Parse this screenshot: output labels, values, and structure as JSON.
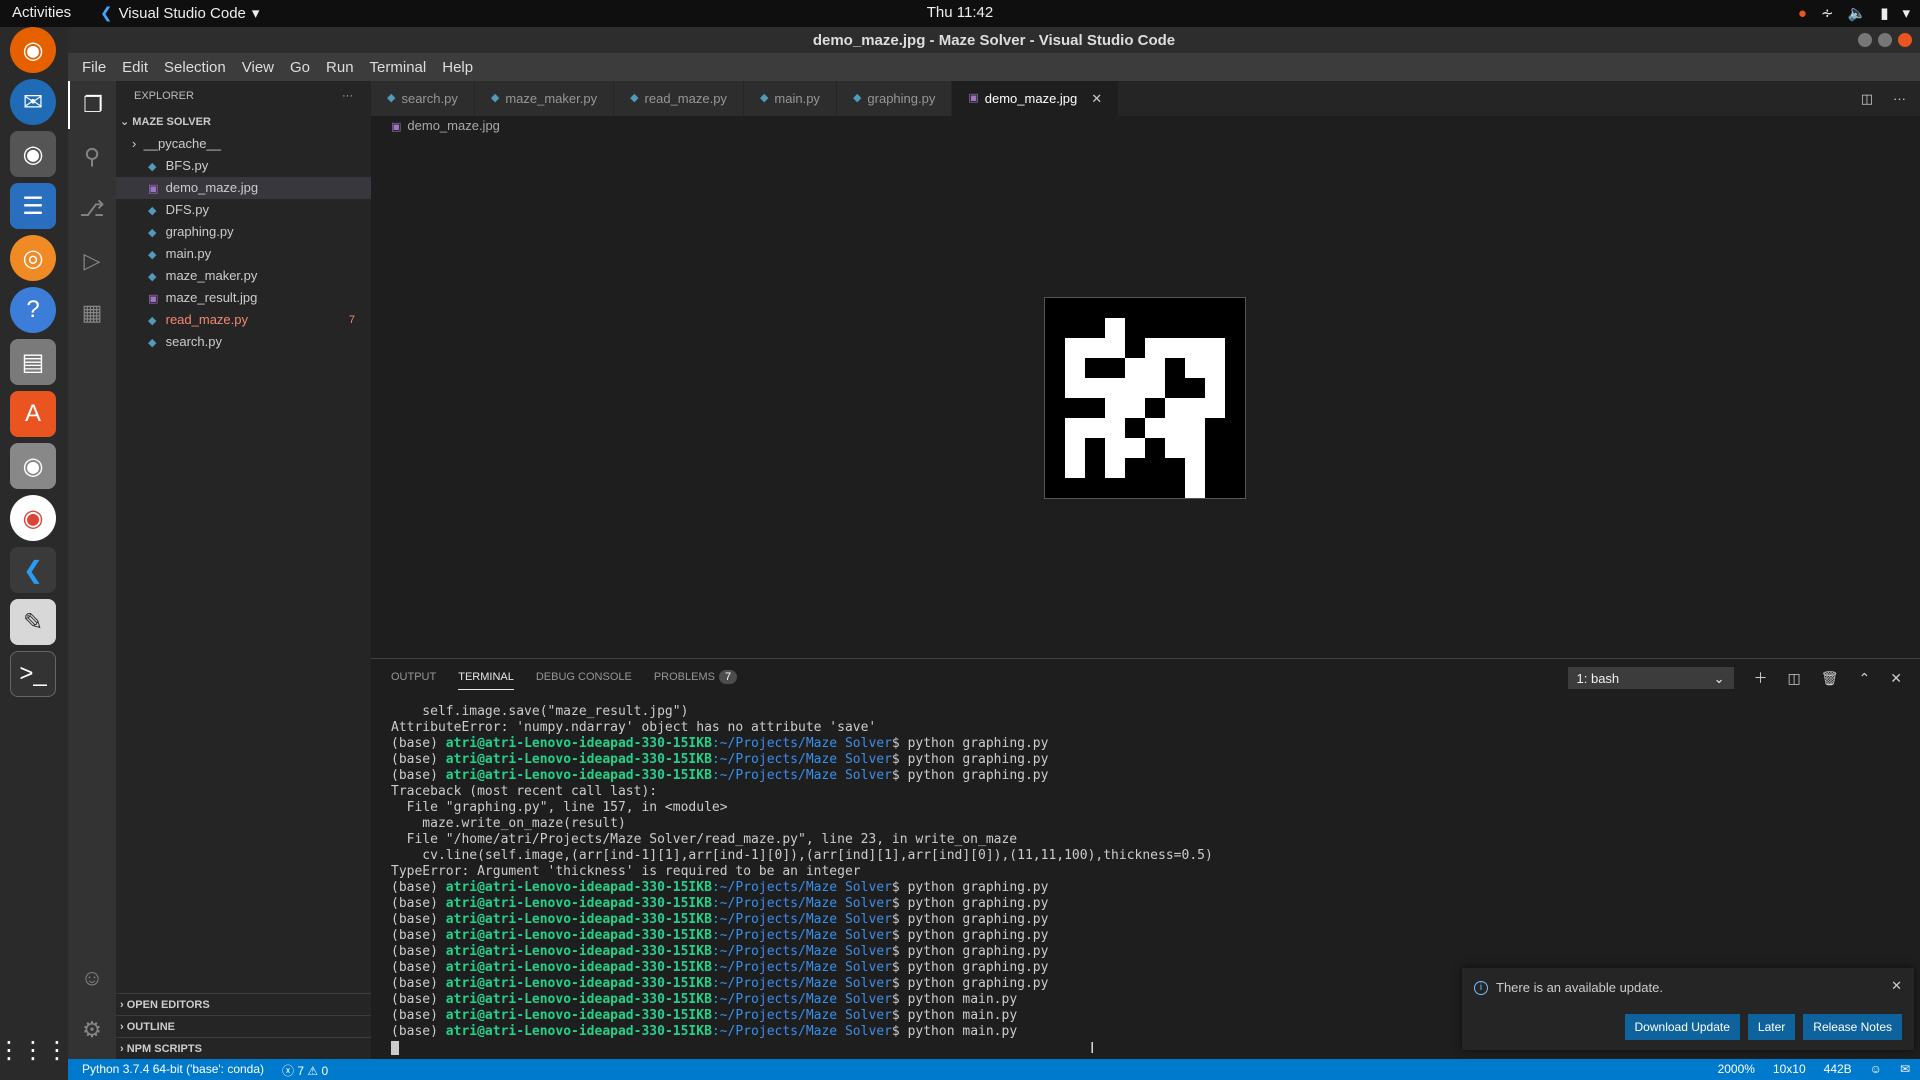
{
  "topbar": {
    "activities": "Activities",
    "app": "Visual Studio Code",
    "clock": "Thu 11:42"
  },
  "window": {
    "title": "demo_maze.jpg - Maze Solver - Visual Studio Code"
  },
  "menu": [
    "File",
    "Edit",
    "Selection",
    "View",
    "Go",
    "Run",
    "Terminal",
    "Help"
  ],
  "sidebar": {
    "header": "EXPLORER",
    "folder": "MAZE SOLVER",
    "items": [
      {
        "label": "__pycache__",
        "kind": "folder"
      },
      {
        "label": "BFS.py",
        "kind": "py"
      },
      {
        "label": "demo_maze.jpg",
        "kind": "img",
        "selected": true
      },
      {
        "label": "DFS.py",
        "kind": "py"
      },
      {
        "label": "graphing.py",
        "kind": "py"
      },
      {
        "label": "main.py",
        "kind": "py"
      },
      {
        "label": "maze_maker.py",
        "kind": "py"
      },
      {
        "label": "maze_result.jpg",
        "kind": "img"
      },
      {
        "label": "read_maze.py",
        "kind": "py",
        "badge": "7"
      },
      {
        "label": "search.py",
        "kind": "py"
      }
    ],
    "bottom": [
      "OPEN EDITORS",
      "OUTLINE",
      "NPM SCRIPTS"
    ]
  },
  "tabs": [
    "search.py",
    "maze_maker.py",
    "read_maze.py",
    "main.py",
    "graphing.py",
    "demo_maze.jpg"
  ],
  "breadcrumb": "demo_maze.jpg",
  "panel": {
    "tabs": [
      "OUTPUT",
      "TERMINAL",
      "DEBUG CONSOLE",
      "PROBLEMS"
    ],
    "problems_count": "7",
    "terminal_select": "1: bash"
  },
  "terminal": {
    "prompt_env": "(base) ",
    "user": "atri@atri-Lenovo-ideapad-330-15IKB",
    "path": ":~/Projects/Maze Solver",
    "lines": [
      {
        "t": "plain",
        "text": "    self.image.save(\"maze_result.jpg\")"
      },
      {
        "t": "plain",
        "text": "AttributeError: 'numpy.ndarray' object has no attribute 'save'"
      },
      {
        "t": "prompt",
        "cmd": "$ python graphing.py"
      },
      {
        "t": "prompt",
        "cmd": "$ python graphing.py"
      },
      {
        "t": "prompt",
        "cmd": "$ python graphing.py"
      },
      {
        "t": "plain",
        "text": "Traceback (most recent call last):"
      },
      {
        "t": "plain",
        "text": "  File \"graphing.py\", line 157, in <module>"
      },
      {
        "t": "plain",
        "text": "    maze.write_on_maze(result)"
      },
      {
        "t": "plain",
        "text": "  File \"/home/atri/Projects/Maze Solver/read_maze.py\", line 23, in write_on_maze"
      },
      {
        "t": "plain",
        "text": "    cv.line(self.image,(arr[ind-1][1],arr[ind-1][0]),(arr[ind][1],arr[ind][0]),(11,11,100),thickness=0.5)"
      },
      {
        "t": "plain",
        "text": "TypeError: Argument 'thickness' is required to be an integer"
      },
      {
        "t": "prompt",
        "cmd": "$ python graphing.py"
      },
      {
        "t": "prompt",
        "cmd": "$ python graphing.py"
      },
      {
        "t": "prompt",
        "cmd": "$ python graphing.py"
      },
      {
        "t": "prompt",
        "cmd": "$ python graphing.py"
      },
      {
        "t": "prompt",
        "cmd": "$ python graphing.py"
      },
      {
        "t": "prompt",
        "cmd": "$ python graphing.py"
      },
      {
        "t": "prompt",
        "cmd": "$ python graphing.py"
      },
      {
        "t": "prompt",
        "cmd": "$ python main.py"
      },
      {
        "t": "prompt",
        "cmd": "$ python main.py"
      },
      {
        "t": "prompt",
        "cmd": "$ python main.py"
      }
    ]
  },
  "notification": {
    "message": "There is an available update.",
    "buttons": [
      "Download Update",
      "Later",
      "Release Notes"
    ]
  },
  "status": {
    "python": "Python 3.7.4 64-bit ('base': conda)",
    "problems": "ⓧ 7 ⚠ 0",
    "zoom": "2000%",
    "dims": "10x10",
    "size": "442B"
  },
  "maze_grid": [
    [
      0,
      0,
      0,
      0,
      0,
      0,
      0,
      0,
      0,
      0
    ],
    [
      0,
      0,
      0,
      1,
      0,
      0,
      0,
      0,
      0,
      0
    ],
    [
      0,
      1,
      1,
      1,
      0,
      1,
      1,
      1,
      1,
      0
    ],
    [
      0,
      1,
      0,
      0,
      1,
      1,
      0,
      1,
      1,
      0
    ],
    [
      0,
      1,
      1,
      1,
      1,
      1,
      0,
      0,
      1,
      0
    ],
    [
      0,
      0,
      0,
      1,
      1,
      0,
      1,
      1,
      1,
      0
    ],
    [
      0,
      1,
      1,
      1,
      0,
      1,
      1,
      1,
      0,
      0
    ],
    [
      0,
      1,
      0,
      1,
      1,
      0,
      1,
      1,
      0,
      0
    ],
    [
      0,
      1,
      0,
      1,
      0,
      0,
      0,
      1,
      0,
      0
    ],
    [
      0,
      0,
      0,
      0,
      0,
      0,
      0,
      1,
      0,
      0
    ]
  ],
  "colors": {
    "accent": "#007acc",
    "maze_wall": "#000000",
    "maze_path": "#ffffff"
  }
}
